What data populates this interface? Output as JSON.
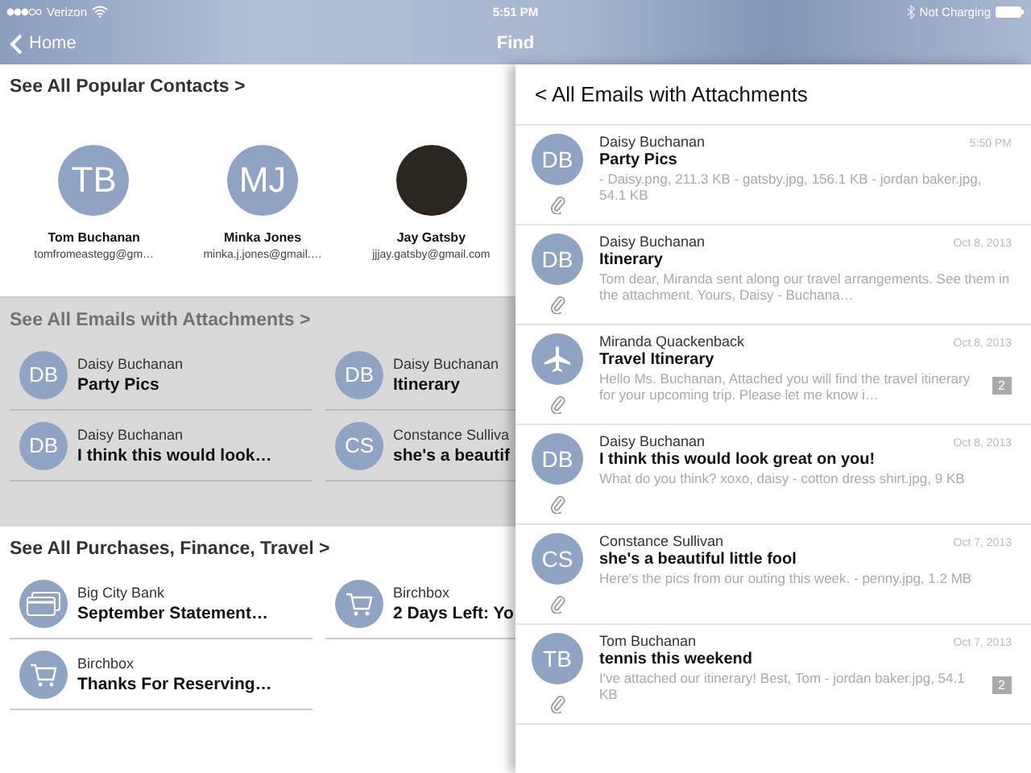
{
  "status_bar": {
    "carrier": "Verizon",
    "time": "5:51 PM",
    "charging": "Not Charging"
  },
  "nav_bar": {
    "back": "Home",
    "title": "Find"
  },
  "popular_contacts": {
    "heading": "See All Popular Contacts >",
    "contacts": [
      {
        "kind": "initials",
        "initials": "TB",
        "name": "Tom Buchanan",
        "email": "tomfromeastegg@gm…"
      },
      {
        "kind": "initials",
        "initials": "MJ",
        "name": "Minka Jones",
        "email": "minka.j.jones@gmail.…"
      },
      {
        "kind": "photo",
        "name": "Jay Gatsby",
        "email": "jjjay.gatsby@gmail.com"
      }
    ]
  },
  "emails_with_attachments": {
    "heading": "See All Emails with Attachments >",
    "items": [
      {
        "initials": "DB",
        "sender": "Daisy Buchanan",
        "subject": "Party Pics"
      },
      {
        "initials": "DB",
        "sender": "Daisy Buchanan",
        "subject": "Itinerary"
      },
      {
        "initials": "DB",
        "sender": "Daisy Buchanan",
        "subject": "I think this would look…"
      },
      {
        "initials": "CS",
        "sender": "Constance Sulliva",
        "subject": "she's a beautif"
      }
    ]
  },
  "purchases": {
    "heading": "See All Purchases, Finance, Travel >",
    "items": [
      {
        "kind": "card",
        "sender": "Big City Bank",
        "subject": "September Statement…"
      },
      {
        "kind": "cart",
        "sender": "Birchbox",
        "subject": "2 Days Left: Yo"
      },
      {
        "kind": "cart",
        "sender": "Birchbox",
        "subject": "Thanks For Reserving…"
      }
    ]
  },
  "attachments_panel": {
    "back_title": "< All Emails with Attachments",
    "emails": [
      {
        "kind": "initials",
        "initials": "DB",
        "sender": "Daisy Buchanan",
        "date": "5:50 PM",
        "subject": "Party Pics",
        "preview": "- Daisy.png, 211.3 KB - gatsby.jpg, 156.1 KB - jordan baker.jpg, 54.1 KB"
      },
      {
        "kind": "initials",
        "initials": "DB",
        "sender": "Daisy Buchanan",
        "date": "Oct 8, 2013",
        "subject": "Itinerary",
        "preview": "Tom dear, Miranda sent along our travel arrangements. See them in the attachment. Yours, Daisy - Buchana…"
      },
      {
        "kind": "plane",
        "sender": "Miranda Quackenback",
        "date": "Oct 8, 2013",
        "subject": "Travel Itinerary",
        "preview": "Hello Ms. Buchanan, Attached you will find the travel itinerary for your upcoming trip. Please let me know i…",
        "count": "2"
      },
      {
        "kind": "initials",
        "initials": "DB",
        "sender": "Daisy Buchanan",
        "date": "Oct 8, 2013",
        "subject": "I think this would look great on you!",
        "preview": "What do you think? xoxo, daisy - cotton dress shirt.jpg, 9 KB"
      },
      {
        "kind": "initials",
        "initials": "CS",
        "sender": "Constance Sullivan",
        "date": "Oct 7, 2013",
        "subject": "she's a beautiful little fool",
        "preview": "Here's the pics from our outing this week. - penny.jpg, 1.2 MB"
      },
      {
        "kind": "initials",
        "initials": "TB",
        "sender": "Tom Buchanan",
        "date": "Oct 7, 2013",
        "subject": "tennis this weekend",
        "preview": "I've attached our itinerary! Best, Tom - jordan baker.jpg, 54.1 KB",
        "count": "2"
      }
    ]
  }
}
